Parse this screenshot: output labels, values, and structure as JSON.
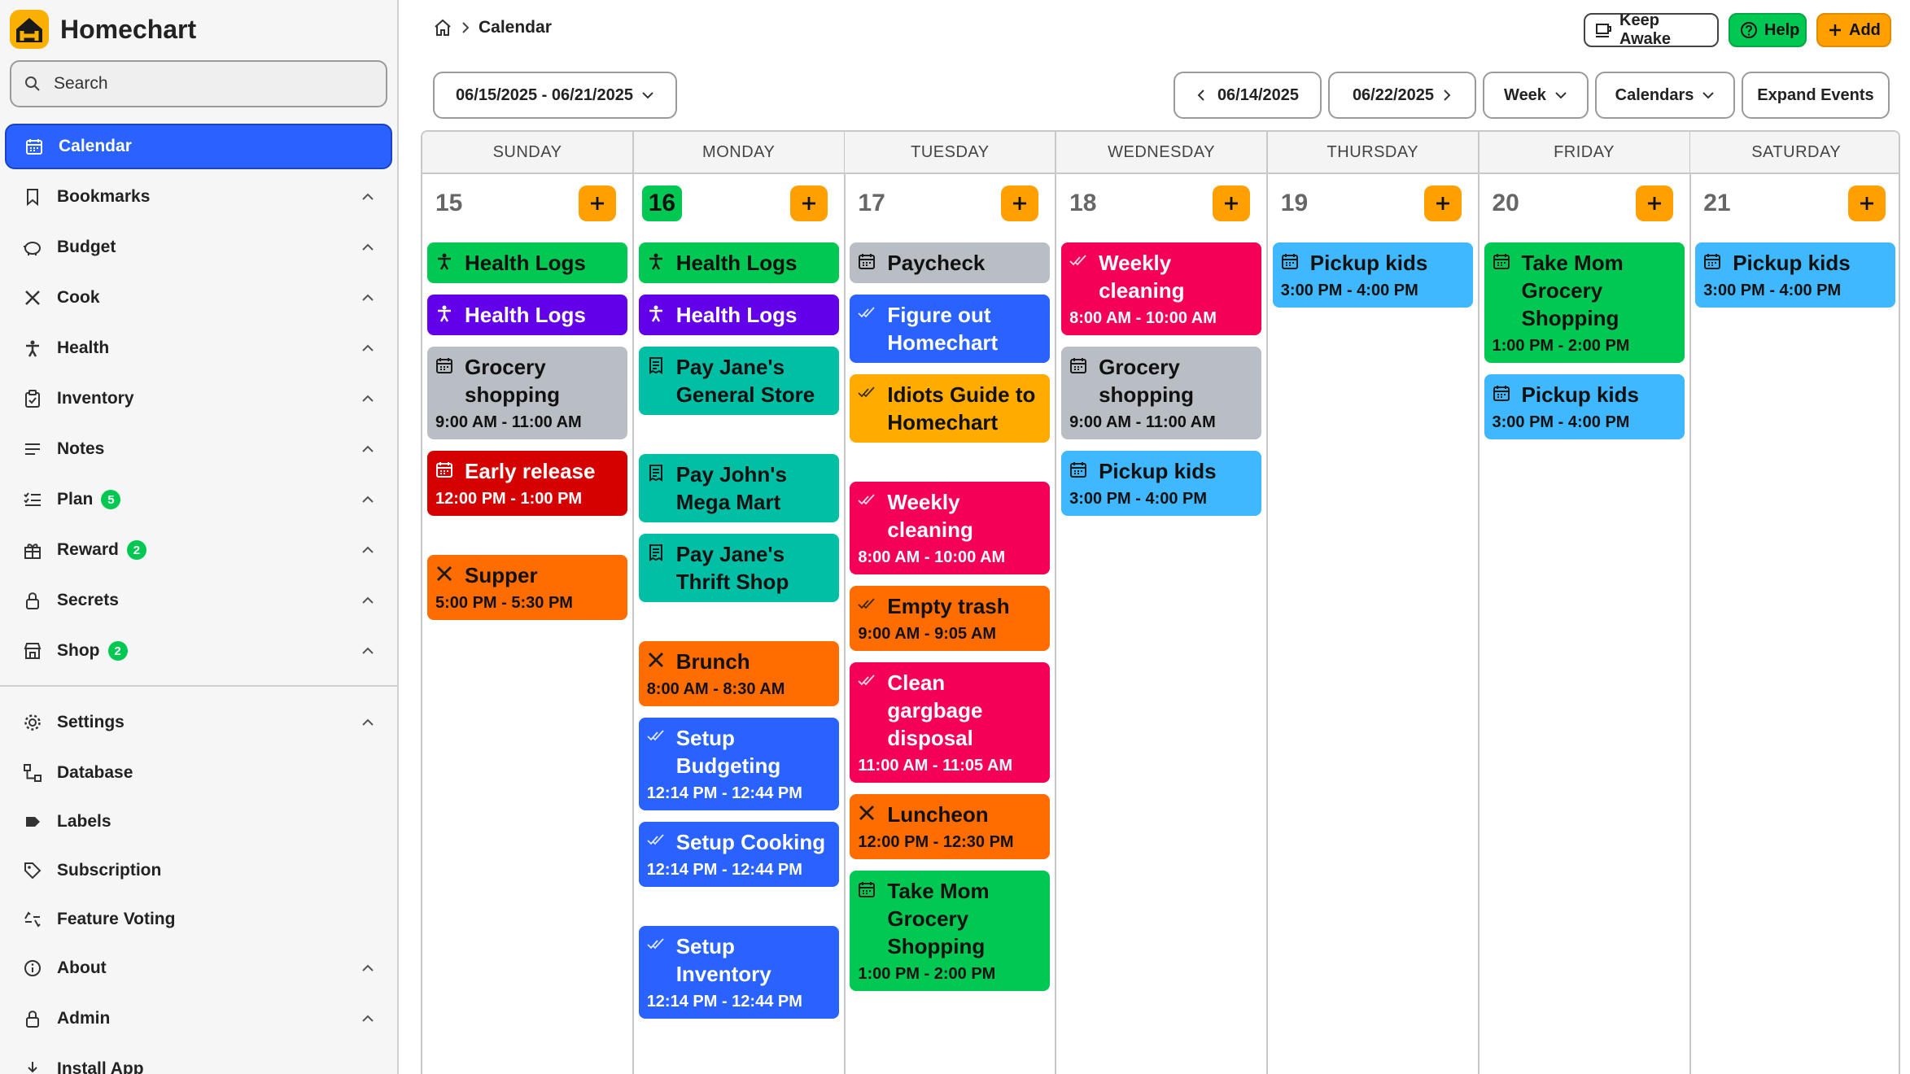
{
  "app": {
    "title": "Homechart"
  },
  "search": {
    "placeholder": "Search"
  },
  "sidebar": {
    "items": [
      {
        "label": "Calendar",
        "icon": "calendar-icon",
        "active": true
      },
      {
        "label": "Bookmarks",
        "icon": "bookmark-icon"
      },
      {
        "label": "Budget",
        "icon": "piggy-bank-icon"
      },
      {
        "label": "Cook",
        "icon": "utensils-icon"
      },
      {
        "label": "Health",
        "icon": "person-icon"
      },
      {
        "label": "Inventory",
        "icon": "clipboard-icon"
      },
      {
        "label": "Notes",
        "icon": "lines-icon"
      },
      {
        "label": "Plan",
        "icon": "checklist-icon",
        "badge": "5"
      },
      {
        "label": "Reward",
        "icon": "gift-icon",
        "badge": "2"
      },
      {
        "label": "Secrets",
        "icon": "lock-icon"
      },
      {
        "label": "Shop",
        "icon": "store-icon",
        "badge": "2"
      }
    ],
    "bottom_items": [
      {
        "label": "Settings",
        "icon": "gear-icon"
      },
      {
        "label": "Database",
        "icon": "database-icon"
      },
      {
        "label": "Labels",
        "icon": "label-icon"
      },
      {
        "label": "Subscription",
        "icon": "tag-icon"
      },
      {
        "label": "Feature Voting",
        "icon": "vote-icon"
      },
      {
        "label": "About",
        "icon": "info-icon"
      },
      {
        "label": "Admin",
        "icon": "lock-icon"
      },
      {
        "label": "Install App",
        "icon": "download-icon"
      }
    ]
  },
  "breadcrumb": {
    "current": "Calendar"
  },
  "header": {
    "keep_awake": "Keep Awake",
    "help": "Help",
    "add": "Add"
  },
  "controls": {
    "range": "06/15/2025 - 06/21/2025",
    "prev": "06/14/2025",
    "next": "06/22/2025",
    "view": "Week",
    "calendars": "Calendars",
    "expand": "Expand Events"
  },
  "days": [
    {
      "name": "SUNDAY",
      "num": "15"
    },
    {
      "name": "MONDAY",
      "num": "16",
      "today": true
    },
    {
      "name": "TUESDAY",
      "num": "17"
    },
    {
      "name": "WEDNESDAY",
      "num": "18"
    },
    {
      "name": "THURSDAY",
      "num": "19"
    },
    {
      "name": "FRIDAY",
      "num": "20"
    },
    {
      "name": "SATURDAY",
      "num": "21"
    }
  ],
  "events": {
    "sun": [
      {
        "title": "Health Logs",
        "time": "",
        "color": "green",
        "icon": "health-icon"
      },
      {
        "title": "Health Logs",
        "time": "",
        "color": "purple",
        "icon": "health-icon"
      },
      {
        "title": "Grocery shopping",
        "time": "9:00 AM - 11:00 AM",
        "color": "grey",
        "icon": "calendar-icon"
      },
      {
        "title": "Early release",
        "time": "12:00 PM - 1:00 PM",
        "color": "red",
        "icon": "calendar-icon"
      },
      {
        "title": "Supper",
        "time": "5:00 PM - 5:30 PM",
        "color": "orange",
        "icon": "utensils-icon"
      }
    ],
    "mon": [
      {
        "title": "Health Logs",
        "time": "",
        "color": "green",
        "icon": "health-icon"
      },
      {
        "title": "Health Logs",
        "time": "",
        "color": "purple",
        "icon": "health-icon"
      },
      {
        "title": "Pay Jane's General Store",
        "time": "",
        "color": "teal",
        "icon": "receipt-icon"
      },
      {
        "title": "Pay John's Mega Mart",
        "time": "",
        "color": "teal",
        "icon": "receipt-icon"
      },
      {
        "title": "Pay Jane's Thrift Shop",
        "time": "",
        "color": "teal",
        "icon": "receipt-icon"
      },
      {
        "title": "Brunch",
        "time": "8:00 AM - 8:30 AM",
        "color": "orange",
        "icon": "utensils-icon"
      },
      {
        "title": "Setup Budgeting",
        "time": "12:14 PM - 12:44 PM",
        "color": "blue",
        "icon": "check-icon"
      },
      {
        "title": "Setup Cooking",
        "time": "12:14 PM - 12:44 PM",
        "color": "blue",
        "icon": "check-icon"
      },
      {
        "title": "Setup Inventory",
        "time": "12:14 PM - 12:44 PM",
        "color": "blue",
        "icon": "check-icon"
      }
    ],
    "tue": [
      {
        "title": "Paycheck",
        "time": "",
        "color": "grey",
        "icon": "calendar-icon"
      },
      {
        "title": "Figure out Homechart",
        "time": "",
        "color": "blue",
        "icon": "check-icon"
      },
      {
        "title": "Idiots Guide to Homechart",
        "time": "",
        "color": "amber",
        "icon": "check-icon"
      },
      {
        "title": "Weekly cleaning",
        "time": "8:00 AM - 10:00 AM",
        "color": "pink",
        "icon": "check-icon"
      },
      {
        "title": "Empty trash",
        "time": "9:00 AM - 9:05 AM",
        "color": "orange",
        "icon": "check-icon"
      },
      {
        "title": "Clean gargbage disposal",
        "time": "11:00 AM - 11:05 AM",
        "color": "pink",
        "icon": "check-icon"
      },
      {
        "title": "Luncheon",
        "time": "12:00 PM - 12:30 PM",
        "color": "orange",
        "icon": "utensils-icon"
      },
      {
        "title": "Take Mom Grocery Shopping",
        "time": "1:00 PM - 2:00 PM",
        "color": "green",
        "icon": "calendar-icon"
      }
    ],
    "wed": [
      {
        "title": "Weekly cleaning",
        "time": "8:00 AM - 10:00 AM",
        "color": "pink",
        "icon": "check-icon"
      },
      {
        "title": "Grocery shopping",
        "time": "9:00 AM - 11:00 AM",
        "color": "grey",
        "icon": "calendar-icon"
      },
      {
        "title": "Pickup kids",
        "time": "3:00 PM - 4:00 PM",
        "color": "sky",
        "icon": "calendar-icon"
      }
    ],
    "thu": [
      {
        "title": "Pickup kids",
        "time": "3:00 PM - 4:00 PM",
        "color": "sky",
        "icon": "calendar-icon"
      }
    ],
    "fri": [
      {
        "title": "Take Mom Grocery Shopping",
        "time": "1:00 PM - 2:00 PM",
        "color": "green",
        "icon": "calendar-icon"
      },
      {
        "title": "Pickup kids",
        "time": "3:00 PM - 4:00 PM",
        "color": "sky",
        "icon": "calendar-icon"
      }
    ],
    "sat": [
      {
        "title": "Pickup kids",
        "time": "3:00 PM - 4:00 PM",
        "color": "sky",
        "icon": "calendar-icon"
      }
    ]
  },
  "colors": {
    "accent": "#2962ff",
    "add": "#ffa000",
    "help": "#00c853",
    "green": "#00c853",
    "purple": "#6200ea",
    "grey": "#b8bec4",
    "red": "#d50000",
    "orange": "#ff6d00",
    "teal": "#00bfa5",
    "blue": "#2962ff",
    "amber": "#ffab00",
    "pink": "#f50057",
    "sky": "#40b8ff"
  }
}
